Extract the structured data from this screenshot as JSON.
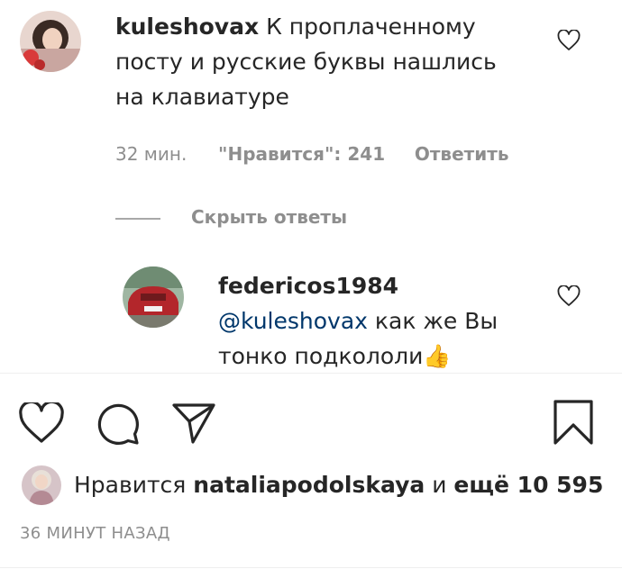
{
  "comment": {
    "username": "kuleshovax",
    "text_line1": "К проплаченному",
    "text_line2": "посту и русские буквы нашлись",
    "text_line3": "на клавиатуре",
    "time": "32 мин.",
    "likes": "\"Нравится\": 241",
    "reply": "Ответить"
  },
  "replies_toggle": {
    "label": "Скрыть ответы"
  },
  "reply_comment": {
    "username": "federicos1984",
    "mention": "@kuleshovax",
    "text_line1_rest": " как же Вы",
    "text_line2": "тонко подкололи",
    "emoji": "👍"
  },
  "actions": {
    "like_icon": "heart-icon",
    "comment_icon": "comment-icon",
    "share_icon": "send-icon",
    "save_icon": "bookmark-icon"
  },
  "likes_summary": {
    "prefix": "Нравится",
    "user": "nataliapodolskaya",
    "middle": "и",
    "rest": "ещё 10 595"
  },
  "timestamp": "36 МИНУТ НАЗАД",
  "colors": {
    "text": "#262626",
    "secondary": "#8e8e8e",
    "mention": "#00376b",
    "divider": "#efefef"
  }
}
